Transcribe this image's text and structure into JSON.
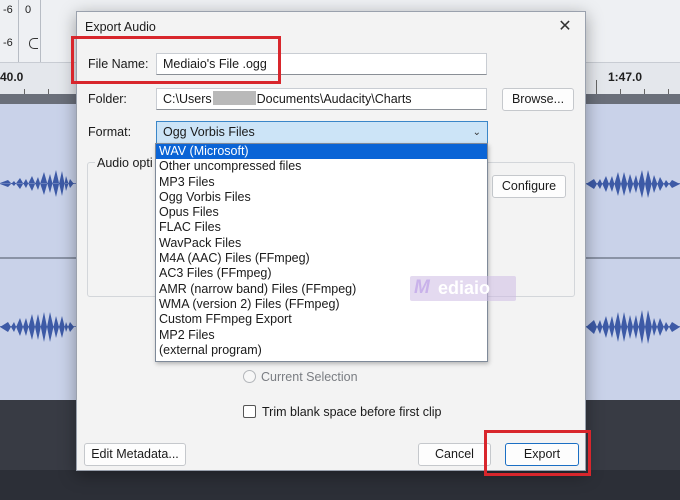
{
  "background": {
    "meter_rows": [
      {
        "left": "-6",
        "right": "0"
      },
      {
        "left": "-6",
        "right": ""
      }
    ],
    "ruler_left": "40.0",
    "ruler_right": "1:47.0"
  },
  "dialog": {
    "title": "Export Audio",
    "close_glyph": "✕",
    "file_name_label": "File Name:",
    "file_name_value": "Mediaio's File .ogg",
    "folder_label": "Folder:",
    "folder_prefix": "C:\\Users",
    "folder_suffix": "Documents\\Audacity\\Charts",
    "browse_label": "Browse...",
    "format_label": "Format:",
    "format_value": "Ogg Vorbis Files",
    "audio_options_label": "Audio opti",
    "configure_label": "Configure",
    "current_selection_label": "Current Selection",
    "trim_label": "Trim blank space before first clip",
    "edit_metadata_label": "Edit Metadata...",
    "cancel_label": "Cancel",
    "export_label": "Export"
  },
  "format_options": [
    "WAV (Microsoft)",
    "Other uncompressed files",
    "MP3 Files",
    "Ogg Vorbis Files",
    "Opus Files",
    "FLAC Files",
    "WavPack Files",
    "M4A (AAC) Files (FFmpeg)",
    "AC3 Files (FFmpeg)",
    "AMR (narrow band) Files (FFmpeg)",
    "WMA (version 2) Files (FFmpeg)",
    "Custom FFmpeg Export",
    "MP2 Files",
    "(external program)"
  ],
  "highlighted_option_index": 0,
  "watermark": {
    "mark": "M",
    "text": "ediaio"
  },
  "colors": {
    "highlight_box": "#d8262c",
    "selection": "#0a64d6",
    "waveform": "#3d5aa6",
    "track": "#c9d2e9"
  }
}
